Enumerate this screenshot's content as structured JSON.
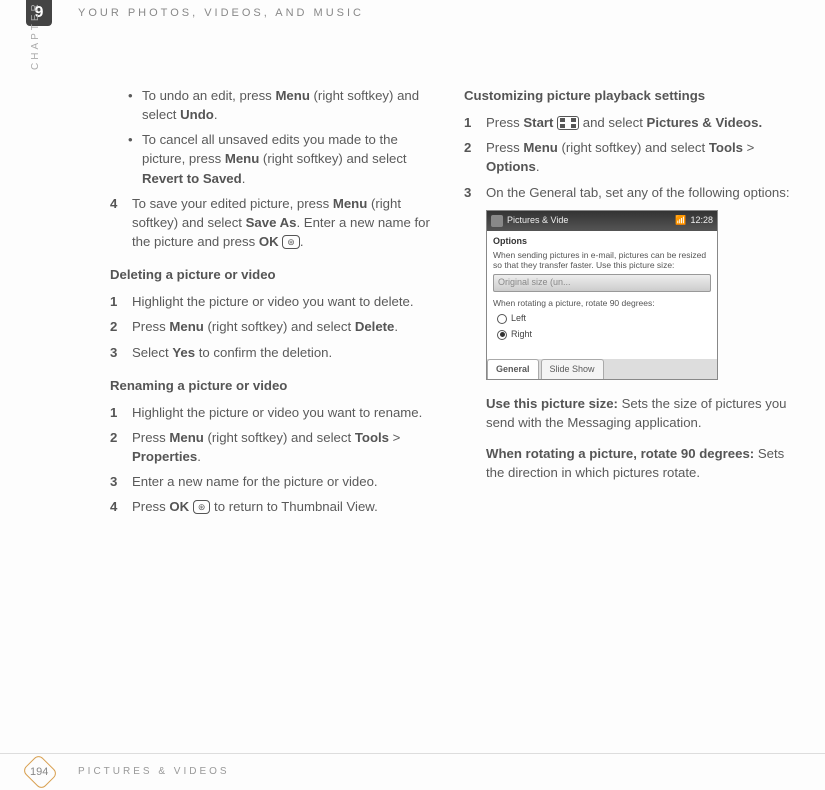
{
  "chapter_number": "9",
  "running_head": "YOUR PHOTOS, VIDEOS, AND MUSIC",
  "chapter_label": "CHAPTER",
  "page_number": "194",
  "footer": "PICTURES & VIDEOS",
  "left": {
    "bullet1_a": "To undo an edit, press ",
    "bullet1_b": "Menu",
    "bullet1_c": " (right softkey) and select ",
    "bullet1_d": "Undo",
    "bullet1_e": ".",
    "bullet2_a": "To cancel all unsaved edits you made to the picture, press ",
    "bullet2_b": "Menu",
    "bullet2_c": " (right softkey) and select ",
    "bullet2_d": "Revert to Saved",
    "bullet2_e": ".",
    "s4n": "4",
    "s4_a": "To save your edited picture, press ",
    "s4_b": "Menu",
    "s4_c": " (right softkey) and select ",
    "s4_d": "Save As",
    "s4_e": ". Enter a new name for the picture and press ",
    "s4_f": "OK",
    "s4_g": ".",
    "delete_head": "Deleting a picture or video",
    "d1n": "1",
    "d1": "Highlight the picture or video you want to delete.",
    "d2n": "2",
    "d2_a": "Press ",
    "d2_b": "Menu",
    "d2_c": " (right softkey) and select ",
    "d2_d": "Delete",
    "d2_e": ".",
    "d3n": "3",
    "d3_a": "Select ",
    "d3_b": "Yes",
    "d3_c": " to confirm the deletion.",
    "rename_head": "Renaming a picture or video",
    "r1n": "1",
    "r1": "Highlight the picture or video you want to rename.",
    "r2n": "2",
    "r2_a": "Press ",
    "r2_b": "Menu",
    "r2_c": " (right softkey) and select ",
    "r2_d": "Tools",
    "r2_e": " > ",
    "r2_f": "Properties",
    "r2_g": ".",
    "r3n": "3",
    "r3": "Enter a new name for the picture or video.",
    "r4n": "4",
    "r4_a": "Press ",
    "r4_b": "OK",
    "r4_c": " to return to Thumbnail View."
  },
  "right": {
    "custom_head": "Customizing picture playback settings",
    "c1n": "1",
    "c1_a": "Press ",
    "c1_b": "Start",
    "c1_c": " and select ",
    "c1_d": "Pictures & Videos.",
    "c2n": "2",
    "c2_a": "Press ",
    "c2_b": "Menu",
    "c2_c": " (right softkey) and select ",
    "c2_d": "Tools",
    "c2_e": " > ",
    "c2_f": "Options",
    "c2_g": ".",
    "c3n": "3",
    "c3": "On the General tab, set any of the following options:",
    "shot": {
      "title": "Pictures & Vide",
      "time": "12:28",
      "options": "Options",
      "desc1": "When sending pictures in e-mail, pictures can be resized so that they transfer faster. Use this picture size:",
      "dropdown": "Original size (un...",
      "desc2": "When rotating a picture, rotate 90 degrees:",
      "radio_left": "Left",
      "radio_right": "Right",
      "tab1": "General",
      "tab2": "Slide Show"
    },
    "opt1_b": "Use this picture size:",
    "opt1_t": " Sets the size of pictures you send with the Messaging application.",
    "opt2_b": "When rotating a picture, rotate 90 degrees:",
    "opt2_t": " Sets the direction in which pictures rotate."
  }
}
